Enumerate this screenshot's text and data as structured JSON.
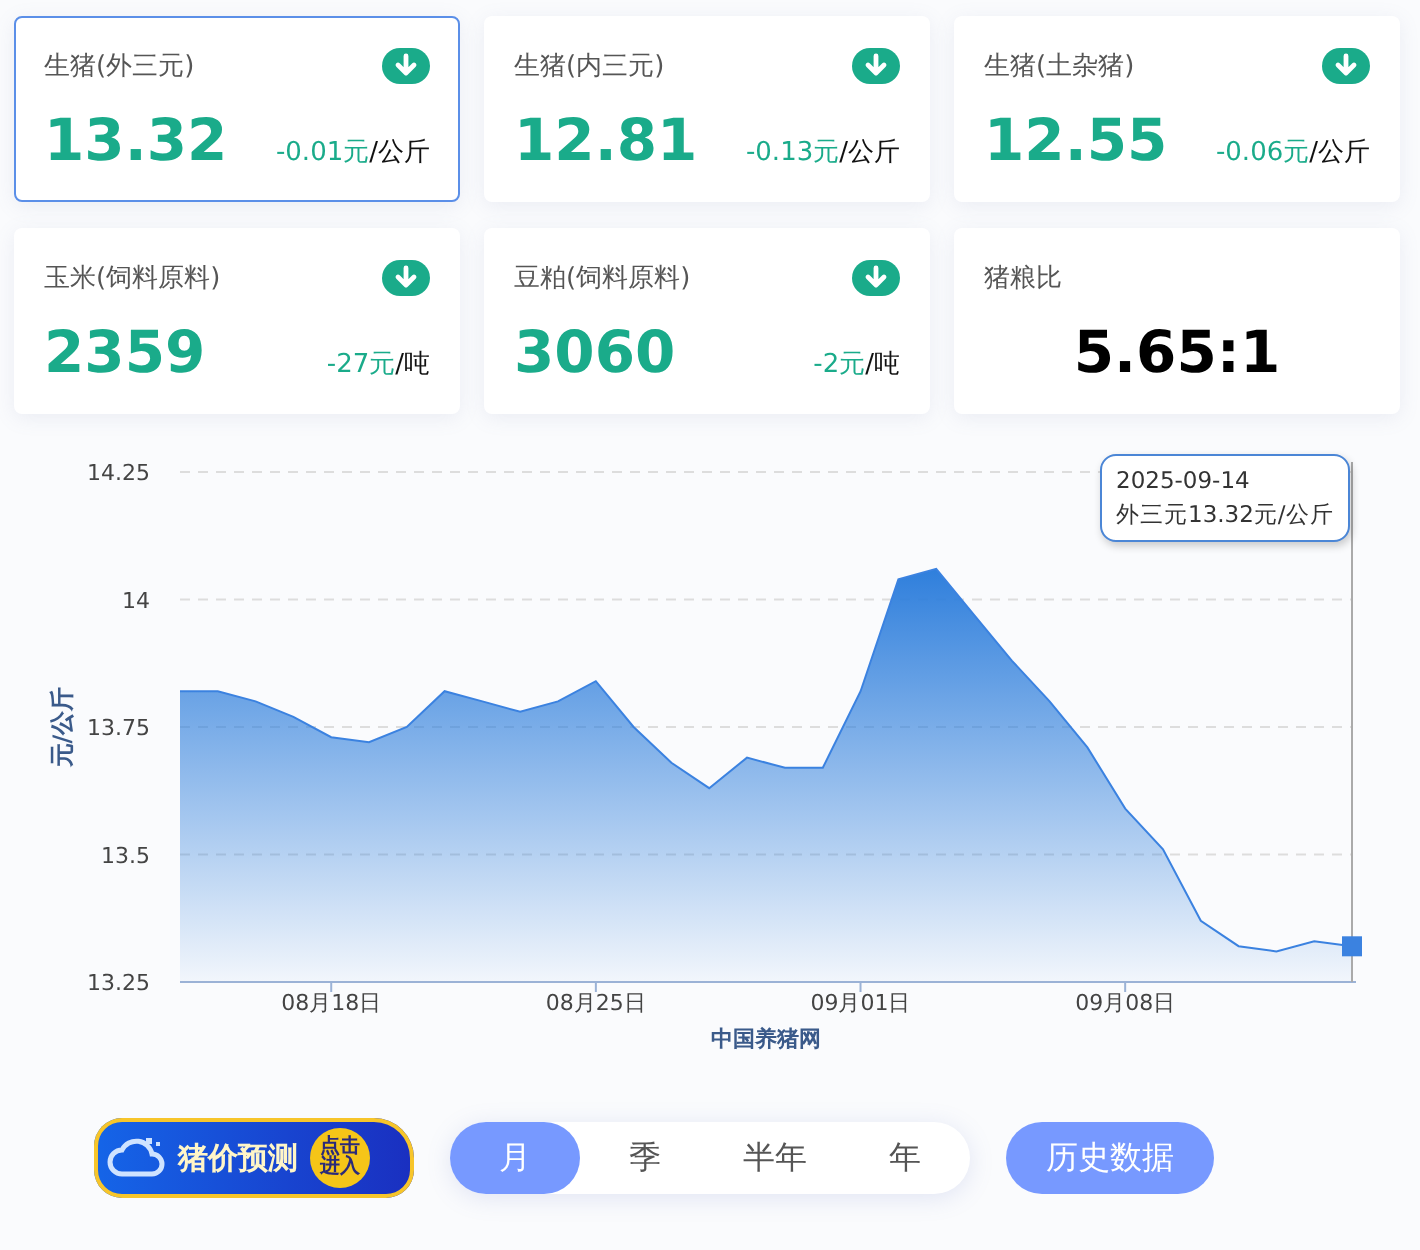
{
  "cards": [
    {
      "title": "生猪(外三元)",
      "value": "13.32",
      "change": "-0.01元",
      "unit": "/公斤",
      "kind": "down",
      "selected": true
    },
    {
      "title": "生猪(内三元)",
      "value": "12.81",
      "change": "-0.13元",
      "unit": "/公斤",
      "kind": "down",
      "selected": false
    },
    {
      "title": "生猪(土杂猪)",
      "value": "12.55",
      "change": "-0.06元",
      "unit": "/公斤",
      "kind": "down",
      "selected": false
    },
    {
      "title": "玉米(饲料原料)",
      "value": "2359",
      "change": "-27元",
      "unit": "/吨",
      "kind": "down",
      "selected": false
    },
    {
      "title": "豆粕(饲料原料)",
      "value": "3060",
      "change": "-2元",
      "unit": "/吨",
      "kind": "down",
      "selected": false
    },
    {
      "title": "猪粮比",
      "value": "5.65:1",
      "kind": "ratio",
      "selected": false
    }
  ],
  "chart": {
    "tooltip": {
      "date": "2025-09-14",
      "text": "外三元13.32元/公斤"
    },
    "chart_data": {
      "type": "area",
      "xlabel": "中国养猪网",
      "ylabel": "元/公斤",
      "categories": [
        null,
        null,
        null,
        null,
        "08月18日",
        null,
        null,
        null,
        null,
        null,
        null,
        "08月25日",
        null,
        null,
        null,
        null,
        null,
        null,
        "09月01日",
        null,
        null,
        null,
        null,
        null,
        null,
        "09月08日",
        null,
        null,
        null,
        null,
        null,
        null
      ],
      "grid": true,
      "series": [
        {
          "color": "#3b82e0",
          "values": [
            13.82,
            13.82,
            13.8,
            13.77,
            13.73,
            13.72,
            13.75,
            13.82,
            13.8,
            13.78,
            13.8,
            13.84,
            13.75,
            13.68,
            13.63,
            13.69,
            13.67,
            13.67,
            13.82,
            14.04,
            14.06,
            13.97,
            13.88,
            13.8,
            13.71,
            13.59,
            13.51,
            13.37,
            13.32,
            13.31,
            13.33,
            13.32
          ]
        }
      ],
      "ylim": [
        13.25,
        14.25
      ],
      "yticks": [
        {
          "value": 13.25,
          "label": "13.25"
        },
        {
          "value": 13.5,
          "label": "13.5"
        },
        {
          "value": 13.75,
          "label": "13.75"
        },
        {
          "value": 14,
          "label": "14"
        },
        {
          "value": 14.25,
          "label": "14.25"
        }
      ]
    }
  },
  "banner": {
    "title": "猪价预测",
    "badge": "点击进入"
  },
  "periods": [
    {
      "label": "月",
      "selected": true
    },
    {
      "label": "季",
      "selected": false
    },
    {
      "label": "半年",
      "selected": false
    },
    {
      "label": "年",
      "selected": false
    }
  ],
  "history_button": "历史数据"
}
